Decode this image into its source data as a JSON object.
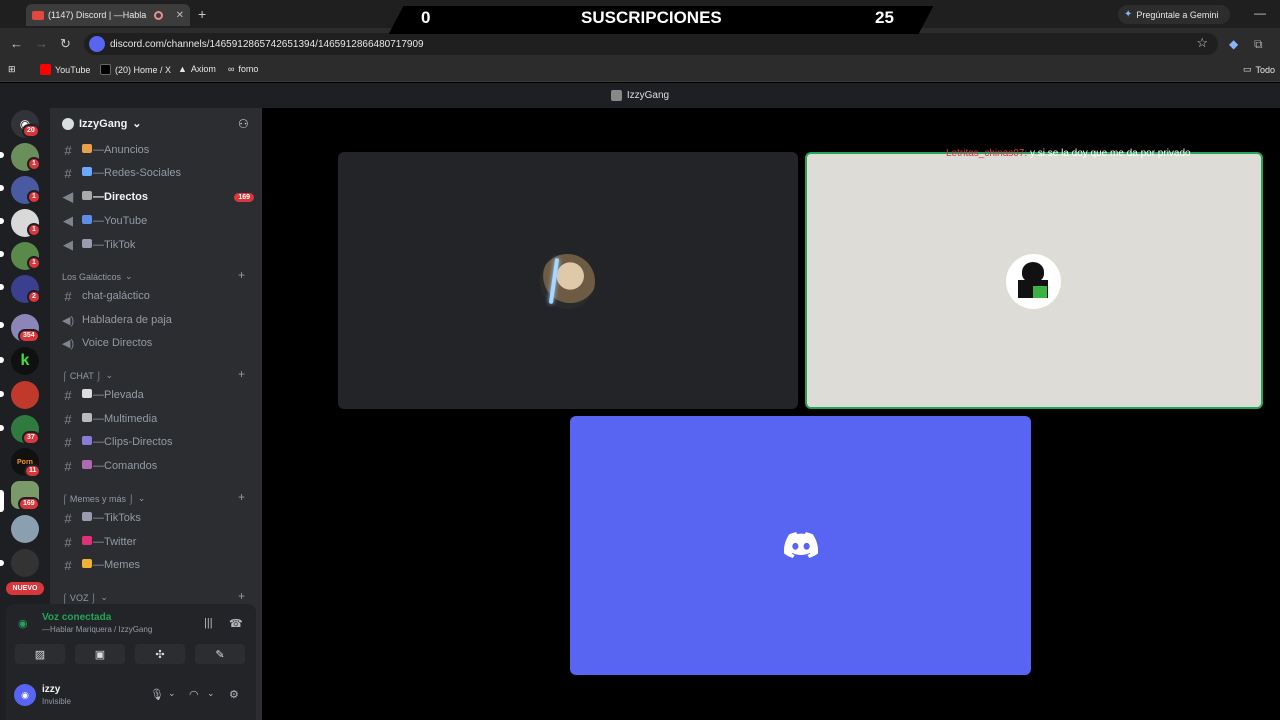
{
  "browser": {
    "tab_title": "(1147) Discord | —Habla",
    "new_tab": "+",
    "url": "discord.com/channels/1465912865742651394/1465912866480717909",
    "gemini": "Pregúntale a Gemini",
    "bookmarks": [
      {
        "label": "YouTube",
        "color": "#ff0000"
      },
      {
        "label": "(20) Home / X",
        "color": "#000000"
      },
      {
        "label": "Axiom",
        "color": "#ffffff"
      },
      {
        "label": "fomo",
        "color": "#333333"
      }
    ],
    "bookmarks_folder": "Todo"
  },
  "overlay": {
    "left_count": "0",
    "title": "SUSCRIPCIONES",
    "right_count": "25"
  },
  "discord": {
    "window_title": "IzzyGang",
    "servers": [
      {
        "badge": "20"
      },
      {
        "badge": "1"
      },
      {
        "badge": "1"
      },
      {
        "badge": "1"
      },
      {
        "badge": "1"
      },
      {
        "badge": "2"
      },
      {
        "badge": "354"
      },
      {
        "badge": ""
      },
      {
        "badge": ""
      },
      {
        "badge": "37"
      },
      {
        "badge": "11"
      },
      {
        "badge": "169"
      },
      {
        "badge": ""
      },
      {
        "badge": ""
      }
    ],
    "new_label": "NUEVO",
    "guild_name": "IzzyGang",
    "channels_top": [
      {
        "label": "—Anuncios",
        "icon": "#",
        "emoji": "#e8a14a"
      },
      {
        "label": "—Redes-Sociales",
        "icon": "#",
        "emoji": "#6aa9ff"
      },
      {
        "label": "—Directos",
        "icon": "📢",
        "emoji": "#aaaaaa",
        "active": true,
        "count": "169"
      },
      {
        "label": "—YouTube",
        "icon": "📢",
        "emoji": "#5c8ee6"
      },
      {
        "label": "—TikTok",
        "icon": "📢",
        "emoji": "#9b9bb0"
      }
    ],
    "categories": {
      "galacticos": "Los Galácticos",
      "chat": "⌠ CHAT ⌡",
      "memes": "⌠ Memes y más ⌡",
      "voz": "⌠ VOZ ⌡"
    },
    "channels_galacticos": [
      {
        "label": "chat-galáctico",
        "icon": "#"
      },
      {
        "label": "Habladera de paja",
        "icon": "🔊"
      },
      {
        "label": "Voice Directos",
        "icon": "🔊"
      }
    ],
    "channels_chat": [
      {
        "label": "—Plevada",
        "emoji": "#dddddd"
      },
      {
        "label": "—Multimedia",
        "emoji": "#bbbbbb"
      },
      {
        "label": "—Clips-Directos",
        "emoji": "#8b7bd8"
      },
      {
        "label": "—Comandos",
        "emoji": "#b06bb0"
      }
    ],
    "channels_memes": [
      {
        "label": "—TikToks",
        "emoji": "#9b9bb0"
      },
      {
        "label": "—Twitter",
        "emoji": "#e0307a"
      },
      {
        "label": "—Memes",
        "emoji": "#f0b232"
      }
    ],
    "voice": {
      "status": "Voz conectada",
      "location": "—Hablar Mariquera / IzzyGang"
    },
    "user": {
      "name": "izzy",
      "status": "Invisible"
    },
    "chat_overlay": {
      "user": "Letritas_chinas07:",
      "message": "y si se la doy que me da por privado"
    },
    "accent": "#5865f2",
    "speaking": "#23a559"
  }
}
